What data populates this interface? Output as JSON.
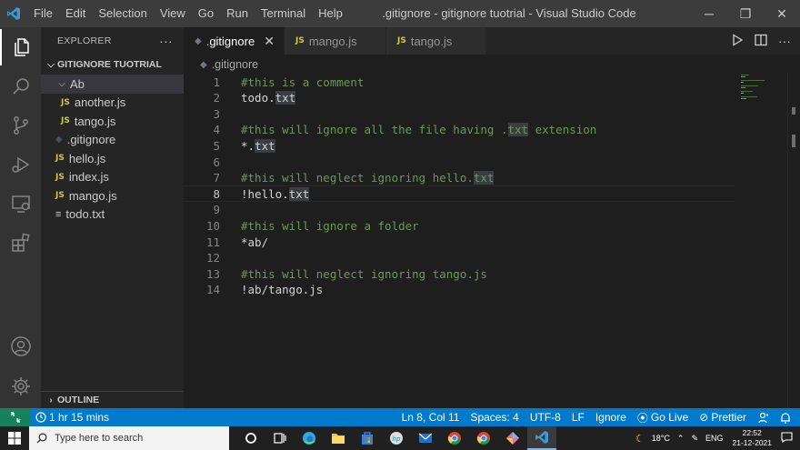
{
  "titlebar": {
    "menu": [
      "File",
      "Edit",
      "Selection",
      "View",
      "Go",
      "Run",
      "Terminal",
      "Help"
    ],
    "title": ".gitignore - gitignore tuotrial - Visual Studio Code",
    "controls": {
      "minimize": "─",
      "maximize": "❐",
      "close": "✕"
    }
  },
  "sidebar": {
    "header": "EXPLORER",
    "more": "···",
    "folder": "GITIGNORE TUOTRIAL",
    "tree": [
      {
        "label": "Ab",
        "kind": "folder"
      },
      {
        "label": "another.js",
        "kind": "js"
      },
      {
        "label": "tango.js",
        "kind": "js"
      },
      {
        "label": ".gitignore",
        "kind": "git"
      },
      {
        "label": "hello.js",
        "kind": "js"
      },
      {
        "label": "index.js",
        "kind": "js"
      },
      {
        "label": "mango.js",
        "kind": "js"
      },
      {
        "label": "todo.txt",
        "kind": "txt"
      }
    ],
    "outline": "OUTLINE",
    "js_badge": "JS"
  },
  "tabs": [
    {
      "label": ".gitignore",
      "active": true
    },
    {
      "label": "mango.js",
      "active": false
    },
    {
      "label": "tango.js",
      "active": false
    }
  ],
  "breadcrumb": ".gitignore",
  "editor": {
    "current_line": 8,
    "lines": [
      "#this is a comment",
      "todo.txt",
      "",
      "#this will ignore all the file having .txt extension",
      "*.txt",
      "",
      "#this will neglect ignoring hello.txt",
      "!hello.txt",
      "",
      "#this will ignore a folder",
      "*ab/",
      "",
      "#this will neglect ignoring tango.js",
      "!ab/tango.js"
    ]
  },
  "statusbar": {
    "time_spent": "1 hr 15 mins",
    "position": "Ln 8, Col 11",
    "spaces": "Spaces: 4",
    "encoding": "UTF-8",
    "eol": "LF",
    "language": "Ignore",
    "go_live": "Go Live",
    "prettier": "Prettier"
  },
  "taskbar": {
    "search_placeholder": "Type here to search",
    "temperature": "18°C",
    "lang": "ENG",
    "time": "22:52",
    "date": "21-12-2021"
  },
  "colors": {
    "accent": "#007acc",
    "comment": "#6a9955",
    "js_icon": "#cbcb41"
  }
}
